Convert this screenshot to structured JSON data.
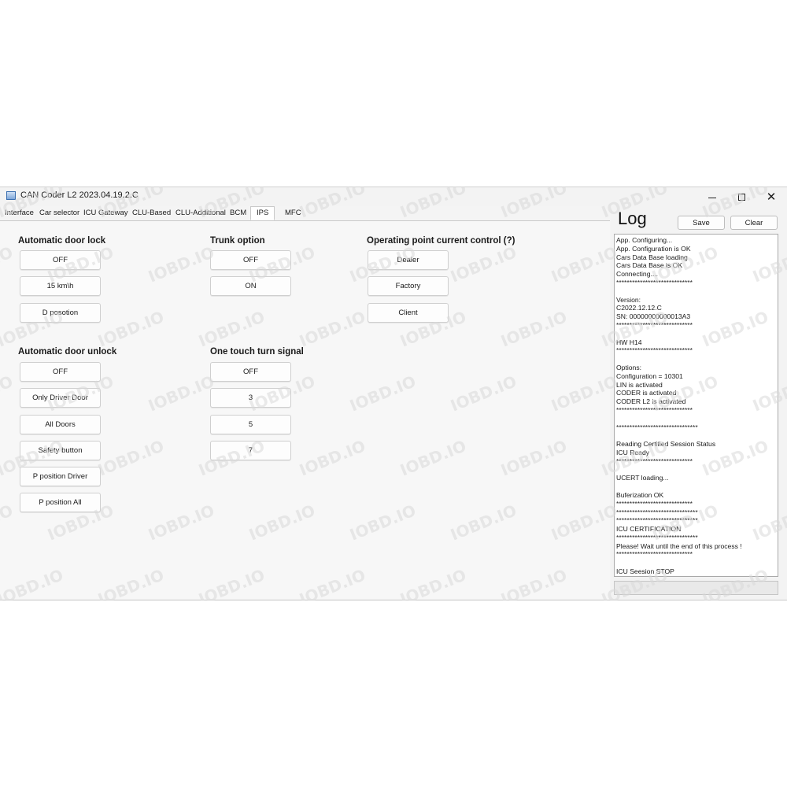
{
  "window": {
    "title": "CAN Coder L2 2023.04.19.2.C",
    "minimize_icon": "minimize-icon",
    "maximize_icon": "maximize-icon",
    "close_glyph": "✕"
  },
  "tabs": [
    {
      "label": "Interface"
    },
    {
      "label": "Car selector"
    },
    {
      "label": "ICU Gateway"
    },
    {
      "label": "CLU-Based"
    },
    {
      "label": "CLU-Additional"
    },
    {
      "label": "BCM"
    },
    {
      "label": "IPS",
      "active": true
    },
    {
      "label": "MFC"
    }
  ],
  "groups": {
    "auto_lock": {
      "title": "Automatic door lock",
      "buttons": [
        "OFF",
        "15 km\\h",
        "D posotion"
      ]
    },
    "trunk": {
      "title": "Trunk option",
      "buttons": [
        "OFF",
        "ON"
      ]
    },
    "op_point": {
      "title": "Operating point current control (?)",
      "buttons": [
        "Dealer",
        "Factory",
        "Client"
      ]
    },
    "auto_unlock": {
      "title": "Automatic door unlock",
      "buttons": [
        "OFF",
        "Only Driver Door",
        "All Doors",
        "Safety button",
        "P position Driver",
        "P position All"
      ]
    },
    "one_touch": {
      "title": "One touch turn signal",
      "buttons": [
        "OFF",
        "3",
        "5",
        "7"
      ]
    }
  },
  "log": {
    "title": "Log",
    "save_label": "Save",
    "clear_label": "Clear",
    "lines": [
      "App. Configuring...",
      "App. Configuration is OK",
      "Cars Data Base loading",
      "Cars Data Base is OK",
      "Connecting....",
      "*****************************",
      "",
      "Version:",
      " C2022.12.12.C",
      "SN:  00000000000013A3",
      "*****************************",
      "",
      "HW H14",
      "*****************************",
      "",
      "Options:",
      "Configuration = 10301",
      "LIN is activated",
      "CODER is activated",
      "CODER L2 is activated",
      "*****************************",
      "",
      "*******************************",
      "",
      "Reading Certified Session Status",
      "ICU Ready",
      "*****************************",
      "",
      "UCERT loading...",
      "",
      "Buferization OK",
      "*****************************",
      "*******************************",
      "*******************************",
      "ICU CERTIFICATION",
      "*******************************",
      "Please! Wait until the end of this process !",
      "*****************************",
      "",
      "ICU Seesion STOP",
      "*****************************"
    ]
  },
  "watermark": {
    "text": "IOBD.IO",
    "color": "#d9d9d9"
  }
}
